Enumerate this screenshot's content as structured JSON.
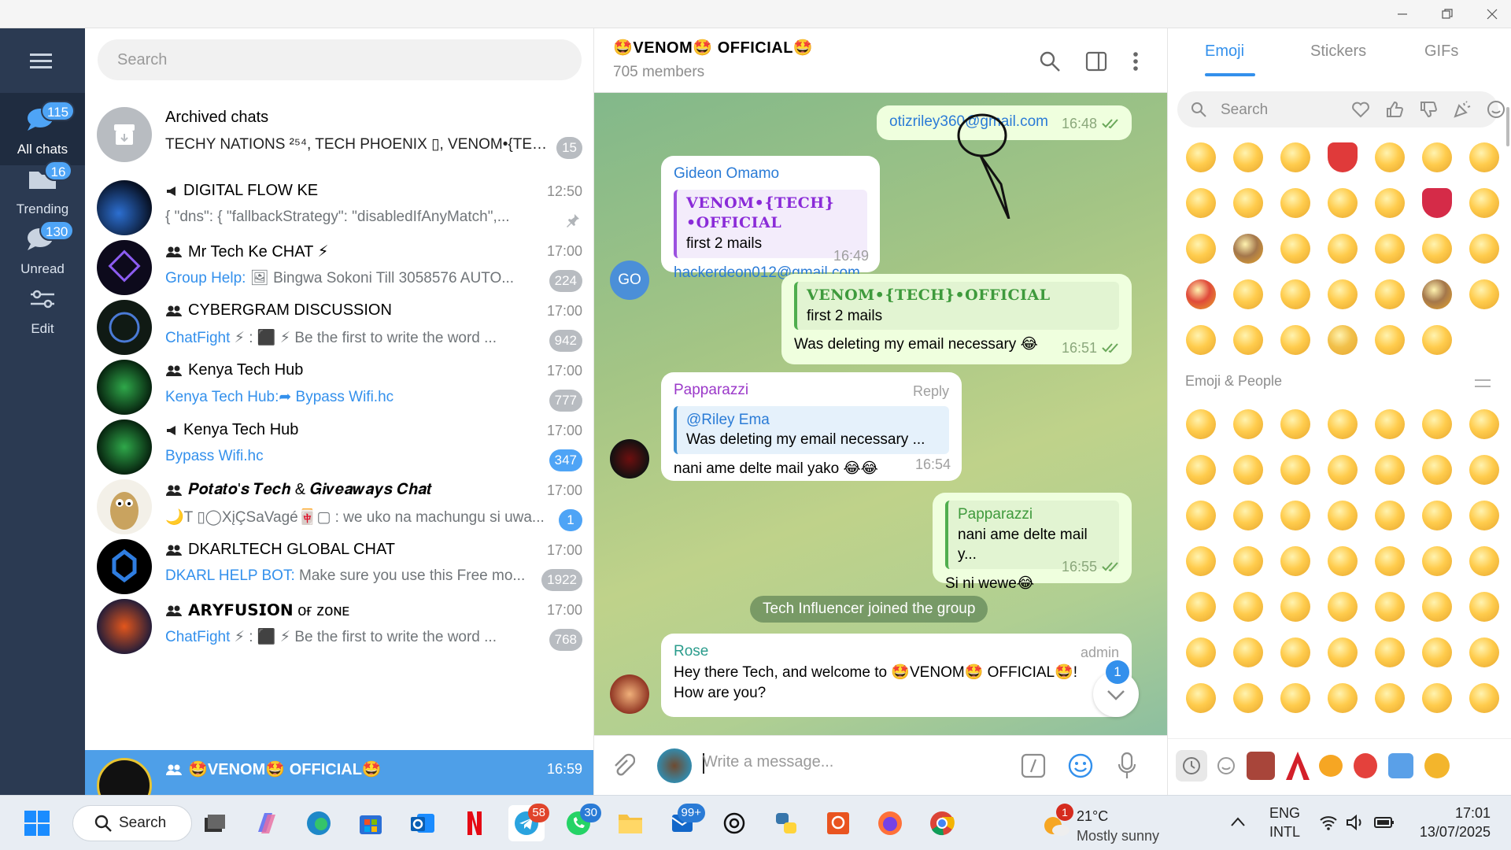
{
  "colors": {
    "accent": "#3390ec",
    "rail_bg": "#2b3a52",
    "active_row": "#4e9fe8",
    "badge_blue": "#4ea4f6",
    "badge_gray": "#b8bcc1",
    "outgoing_bubble": "#efffde"
  },
  "rail": {
    "items": [
      {
        "label": "All chats",
        "badge": "115",
        "icon": "chat-bubbles-icon"
      },
      {
        "label": "Trending",
        "badge": "16",
        "icon": "folder-icon"
      },
      {
        "label": "Unread",
        "badge": "130",
        "icon": "chat-bubble-icon"
      },
      {
        "label": "Edit",
        "badge": "",
        "icon": "sliders-icon"
      }
    ]
  },
  "chatlist": {
    "search_placeholder": "Search",
    "archived": {
      "name": "Archived chats",
      "preview": "TECHY NATIONS ²⁵⁴, TECH PHOENIX ▯, VENOM•{TEC...",
      "count": "15"
    },
    "chats": [
      {
        "name": "DIGITAL FLOW KE",
        "type": "channel",
        "time": "12:50",
        "sender": "",
        "preview": "{   \"dns\": {     \"fallbackStrategy\": \"disabledIfAnyMatch\",...",
        "count": "",
        "pinned": true
      },
      {
        "name": "Mr Tech Ke CHAT ⚡",
        "type": "group",
        "time": "17:00",
        "sender": "Group Help:",
        "preview": " 🖼 Bingwa Sokoni Till  3058576  AUTO...",
        "count": "224"
      },
      {
        "name": "CYBERGRAM DISCUSSION",
        "type": "group",
        "time": "17:00",
        "sender": "ChatFight",
        "preview": " ⚡ : ⬛ ⚡ Be the first to write the word ...",
        "count": "942"
      },
      {
        "name": "Kenya Tech Hub",
        "type": "group",
        "time": "17:00",
        "sender": "Kenya Tech Hub:",
        "preview": "➦ Bypass Wifi.hc",
        "count": "777"
      },
      {
        "name": "Kenya Tech Hub",
        "type": "channel",
        "time": "17:00",
        "sender": "Bypass Wifi.hc",
        "preview": "",
        "count": "347",
        "count_blue": true
      },
      {
        "name": "𝑷𝒐𝒕𝒂𝒕𝒐'𝒔 𝑻𝒆𝒄𝒉 & 𝑮𝒊𝒗𝒆𝒂𝒘𝒂𝒚𝒔 𝑪𝒉𝒂𝒕",
        "type": "group",
        "time": "17:00",
        "sender": "",
        "preview": "🌙T ▯◯XįÇSaVagé🀄▢ : we uko na machungu si uwa...",
        "count": "1",
        "count_blue": true
      },
      {
        "name": "DKARLTECH GLOBAL CHAT",
        "type": "group",
        "time": "17:00",
        "sender": "DKARL HELP BOT:",
        "preview": " Make sure you use this Free mo...",
        "count": "1922"
      },
      {
        "name": "𝗔𝗥𝗬𝗙𝗨𝗦𝗜𝗢𝗡 ᴏғ ᴢᴏɴᴇ",
        "type": "group",
        "time": "17:00",
        "sender": "ChatFight",
        "preview": " ⚡ : ⬛ ⚡ Be the first to write the word ...",
        "count": "768"
      },
      {
        "name": "🤩VENOM🤩 OFFICIAL🤩",
        "type": "group",
        "time": "16:59",
        "sender": "",
        "preview": "",
        "count": "",
        "active": true
      }
    ]
  },
  "chat": {
    "title": "🤩VENOM🤩 OFFICIAL🤩",
    "subtitle": "705 members",
    "messages": {
      "m1": {
        "text": "otizriley360@gmail.com",
        "time": "16:48"
      },
      "m2": {
        "author": "Gideon Omamo",
        "avatar_initials": "GO",
        "quote_author": "VENOM•{TECH}•OFFICIAL",
        "quote_text": "first 2 mails",
        "text": "hackerdeon012@gmail.com",
        "time": "16:49"
      },
      "m3": {
        "quote_author": "VENOM•{TECH}•OFFICIAL",
        "quote_text": "first 2 mails",
        "text": "Was deleting my email necessary 😂",
        "time": "16:51"
      },
      "m4": {
        "author": "Papparazzi",
        "reply_label": "Reply",
        "quote_author": "@Riley Ema",
        "quote_text": "Was deleting my email necessary ...",
        "text": "nani ame delte mail yako 😂😂",
        "time": "16:54"
      },
      "m5": {
        "quote_author": "Papparazzi",
        "quote_text": "nani ame delte mail y...",
        "text": "Si ni wewe😂",
        "time": "16:55"
      },
      "service": "Tech Influencer joined the group",
      "m6": {
        "author": "Rose",
        "role": "admin",
        "text": "Hey there Tech, and welcome to 🤩VENOM🤩 OFFICIAL🤩! How are you?",
        "unread": "1"
      }
    },
    "composer_placeholder": "Write a message..."
  },
  "emoji_panel": {
    "tabs": [
      "Emoji",
      "Stickers",
      "GIFs"
    ],
    "search_placeholder": "Search",
    "section_label": "Emoji & People",
    "recent": [
      "😂",
      "😳",
      "😘",
      "❤️",
      "😍",
      "😊",
      "😁",
      "👍",
      "☺️",
      "😔",
      "😄",
      "😭",
      "💋",
      "😒",
      "😜",
      "🙈",
      "😉",
      "😃",
      "😢",
      "😝",
      "😱",
      "😡",
      "😏",
      "😞",
      "😅",
      "😚",
      "🐵",
      "😌",
      "😀",
      "😋",
      "😆",
      "👌",
      "😐",
      "😕"
    ],
    "people": [
      "😀",
      "😃",
      "😄",
      "😁",
      "😆",
      "🥹",
      "😅",
      "😂",
      "🤣",
      "🥲",
      "☺️",
      "😊",
      "😇",
      "🙂",
      "🙃",
      "😉",
      "😌",
      "😍",
      "🥰",
      "😘",
      "😗",
      "😙",
      "😚",
      "😋",
      "😛",
      "😝",
      "😜",
      "🤪",
      "🤨",
      "🧐",
      "🤓",
      "😎",
      "🥸",
      "🤩",
      "🥳",
      "🙂‍↕️",
      "😏",
      "😒",
      "🙂‍↔️",
      "😞",
      "😔",
      "😟",
      "😕",
      "🙁",
      "☹️",
      "😣",
      "😖",
      "😫",
      "😩",
      "🥺",
      "😢",
      "😭",
      "😤",
      "😠",
      "😡",
      "🤬"
    ]
  },
  "taskbar": {
    "search_label": "Search",
    "badges": {
      "telegram": "58",
      "whatsapp": "30",
      "outlook": "99+"
    },
    "weather": {
      "temp": "21°C",
      "desc": "Mostly sunny",
      "alert": "1"
    },
    "lang": [
      "ENG",
      "INTL"
    ],
    "time": "17:01",
    "date": "13/07/2025"
  }
}
